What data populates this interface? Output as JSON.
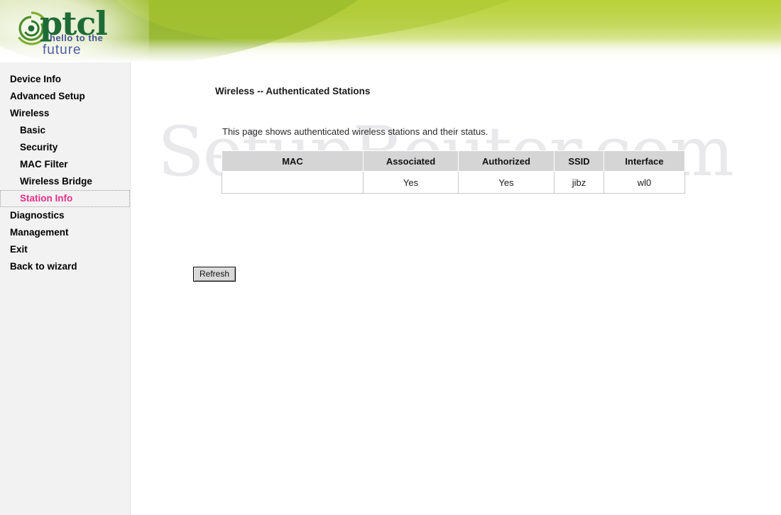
{
  "branding": {
    "logo_wordmark": "ptcl",
    "tagline_line1": "hello to the",
    "tagline_line2": "future",
    "accent_green": "#b9d23a",
    "logo_green": "#1e6b35",
    "tagline_blue": "#3b4aa0"
  },
  "watermark": {
    "text": "SetupRouter.com",
    "color": "#e9e9ec"
  },
  "sidebar": {
    "items": [
      {
        "label": "Device Info",
        "level": "top",
        "active": false
      },
      {
        "label": "Advanced Setup",
        "level": "top",
        "active": false
      },
      {
        "label": "Wireless",
        "level": "top",
        "active": false
      },
      {
        "label": "Basic",
        "level": "sub",
        "active": false
      },
      {
        "label": "Security",
        "level": "sub",
        "active": false
      },
      {
        "label": "MAC Filter",
        "level": "sub",
        "active": false
      },
      {
        "label": "Wireless Bridge",
        "level": "sub",
        "active": false
      },
      {
        "label": "Station Info",
        "level": "sub",
        "active": true
      },
      {
        "label": "Diagnostics",
        "level": "top",
        "active": false
      },
      {
        "label": "Management",
        "level": "top",
        "active": false
      },
      {
        "label": "Exit",
        "level": "top",
        "active": false
      },
      {
        "label": "Back to wizard",
        "level": "top",
        "active": false
      }
    ],
    "active_color": "#e5308c"
  },
  "main": {
    "title": "Wireless -- Authenticated Stations",
    "description": "This page shows authenticated wireless stations and their status.",
    "table": {
      "headers": [
        "MAC",
        "Associated",
        "Authorized",
        "SSID",
        "Interface"
      ],
      "rows": [
        {
          "mac": "",
          "associated": "Yes",
          "authorized": "Yes",
          "ssid": "jibz",
          "interface": "wl0"
        }
      ]
    },
    "refresh_label": "Refresh"
  }
}
